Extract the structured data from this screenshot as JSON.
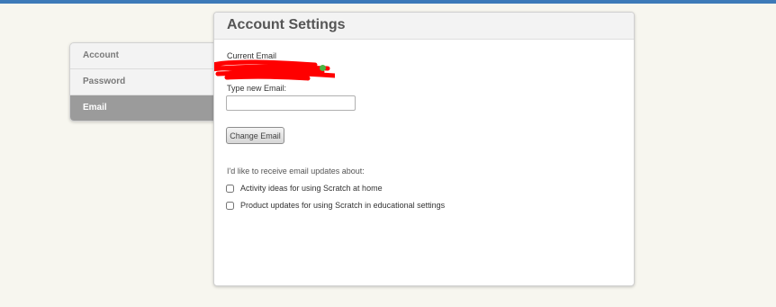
{
  "sidebar": {
    "items": [
      {
        "label": "Account"
      },
      {
        "label": "Password"
      },
      {
        "label": "Email",
        "active": true
      }
    ]
  },
  "panel": {
    "title": "Account Settings",
    "current_email_label": "Current Email",
    "new_email_label": "Type new Email:",
    "new_email_value": "",
    "change_button_label": "Change Email",
    "updates_prompt": "I'd like to receive email updates about:",
    "options": [
      {
        "label": "Activity ideas for using Scratch at home",
        "checked": false
      },
      {
        "label": "Product updates for using Scratch in educational settings",
        "checked": false
      }
    ]
  },
  "colors": {
    "top_bar": "#3d7ab8",
    "active_sidebar_item": "#9b9b9b",
    "verified_indicator": "#4bb543",
    "redaction_mark": "#ff0000"
  }
}
